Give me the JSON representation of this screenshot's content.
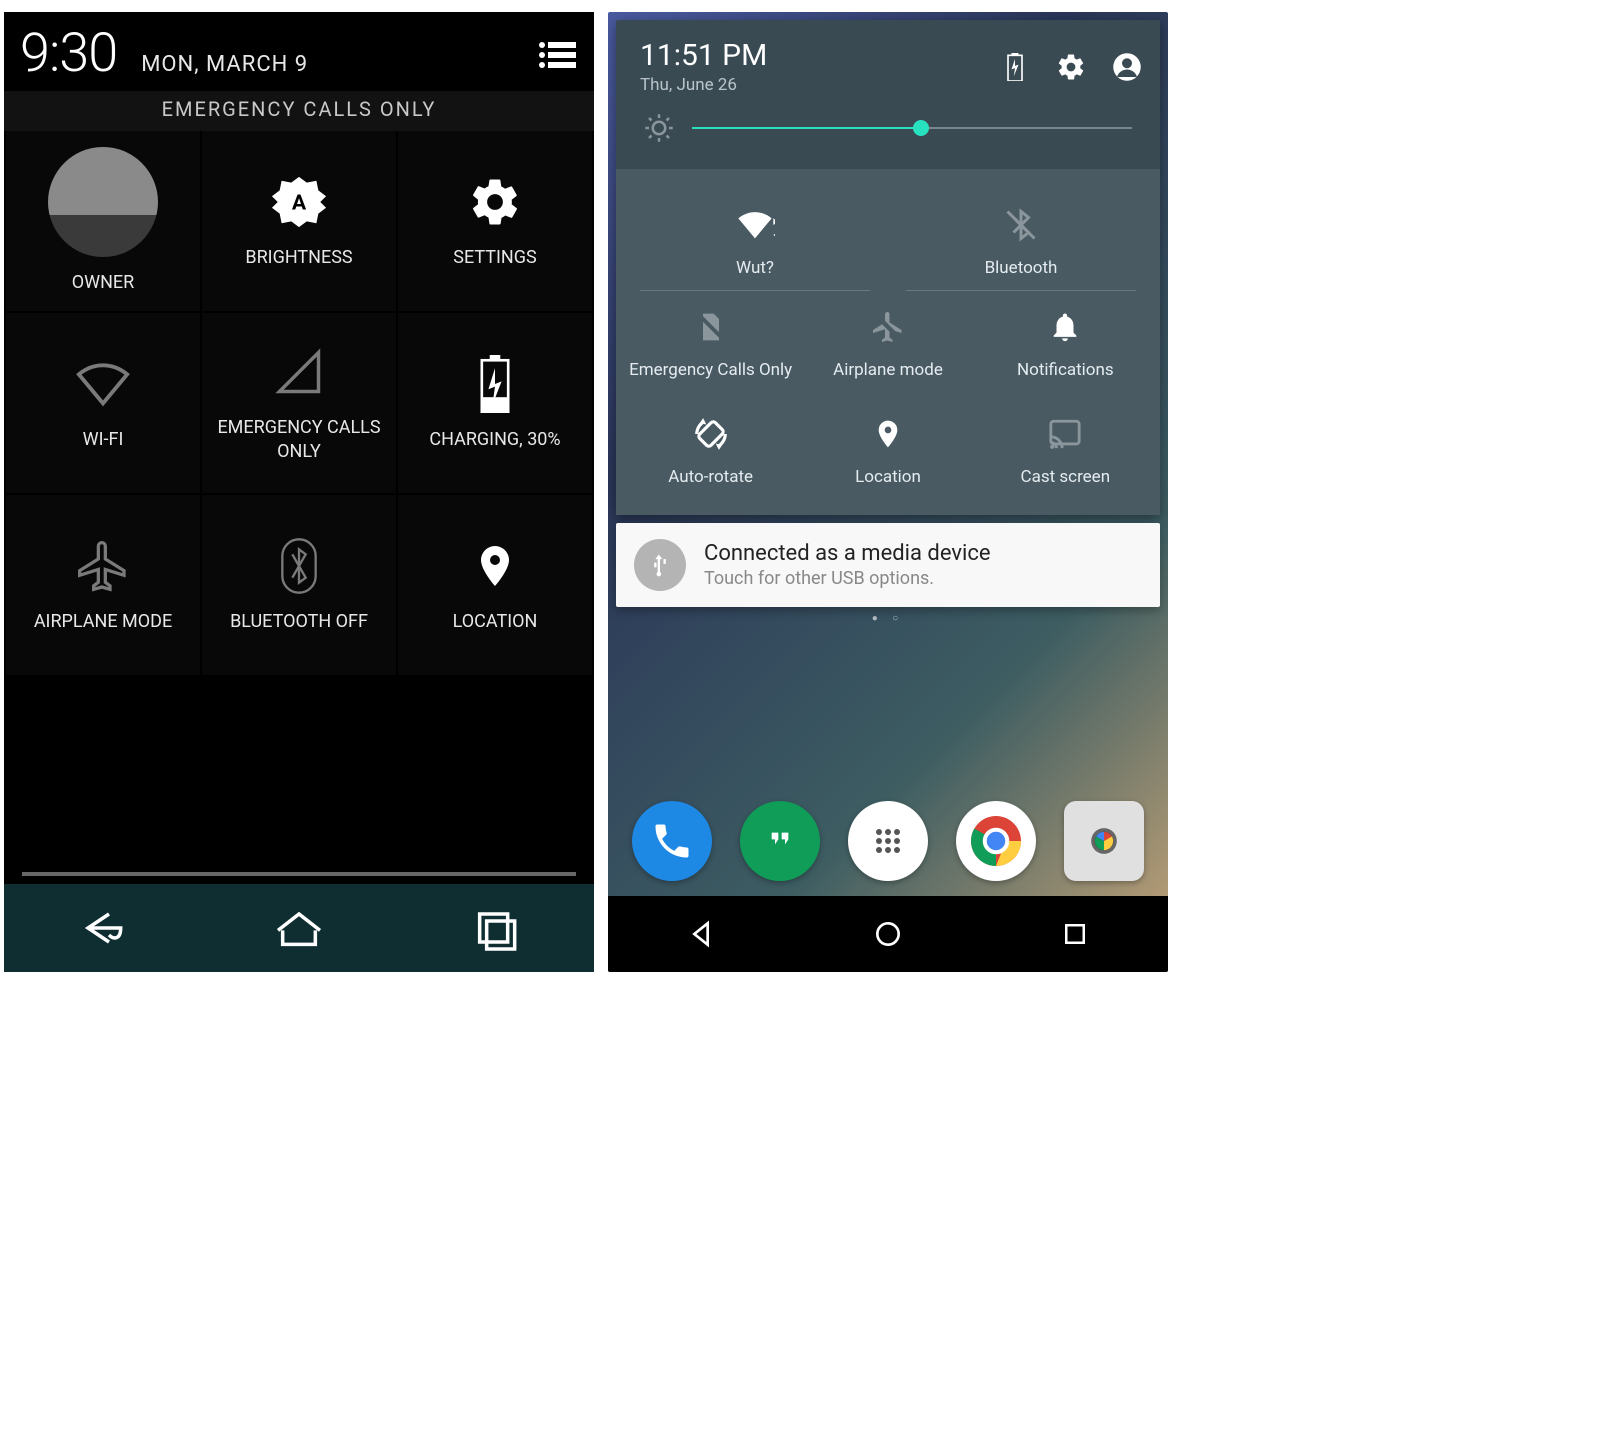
{
  "left": {
    "time": "9:30",
    "date": "MON, MARCH 9",
    "emergency_banner": "EMERGENCY CALLS ONLY",
    "tiles": {
      "owner": "OWNER",
      "brightness": "BRIGHTNESS",
      "settings": "SETTINGS",
      "wifi": "WI-FI",
      "cell": "EMERGENCY CALLS ONLY",
      "battery": "CHARGING, 30%",
      "airplane": "AIRPLANE MODE",
      "bluetooth": "BLUETOOTH OFF",
      "location": "LOCATION"
    }
  },
  "right": {
    "time": "11:51 PM",
    "date": "Thu, June 26",
    "brightness_pct": 52,
    "tiles": {
      "wifi": "Wut?",
      "bluetooth": "Bluetooth",
      "cell": "Emergency Calls Only",
      "airplane": "Airplane mode",
      "notifications": "Notifications",
      "autorotate": "Auto-rotate",
      "location": "Location",
      "cast": "Cast screen"
    },
    "notification": {
      "title": "Connected as a media device",
      "subtitle": "Touch for other USB options."
    }
  }
}
